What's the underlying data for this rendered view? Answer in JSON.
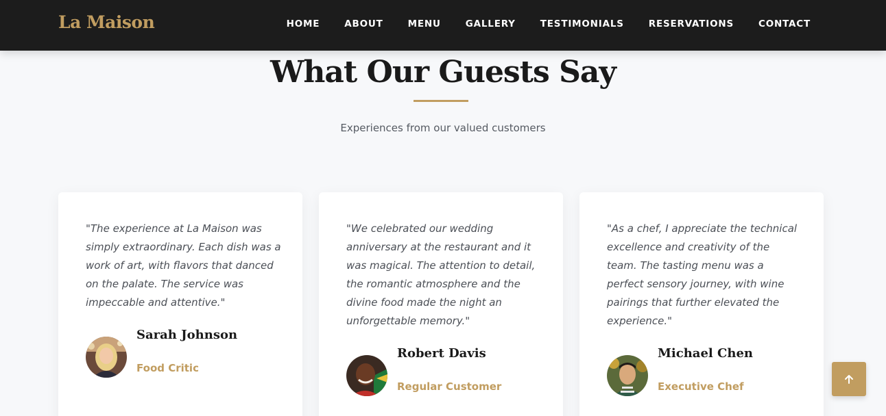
{
  "brand": {
    "name": "La Maison"
  },
  "nav": {
    "items": [
      "HOME",
      "ABOUT",
      "MENU",
      "GALLERY",
      "TESTIMONIALS",
      "RESERVATIONS",
      "CONTACT"
    ]
  },
  "section": {
    "title": "What Our Guests Say",
    "subtitle": "Experiences from our valued customers"
  },
  "testimonials": [
    {
      "quote": "\"The experience at La Maison was simply extraordinary. Each dish was a work of art, with flavors that danced on the palate. The service was impeccable and attentive.\"",
      "name": "Sarah Johnson",
      "role": "Food Critic"
    },
    {
      "quote": "\"We celebrated our wedding anniversary at the restaurant and it was magical. The attention to detail, the romantic atmosphere and the divine food made the night an unforgettable memory.\"",
      "name": "Robert Davis",
      "role": "Regular Customer"
    },
    {
      "quote": "\"As a chef, I appreciate the technical excellence and creativity of the team. The tasting menu was a perfect sensory journey, with wine pairings that further elevated the experience.\"",
      "name": "Michael Chen",
      "role": "Executive Chef"
    }
  ],
  "colors": {
    "accent": "#c19d60",
    "navbar": "#1c1c1c",
    "background": "#f7f8fa"
  },
  "back_to_top": {
    "icon": "arrow-up-icon"
  }
}
